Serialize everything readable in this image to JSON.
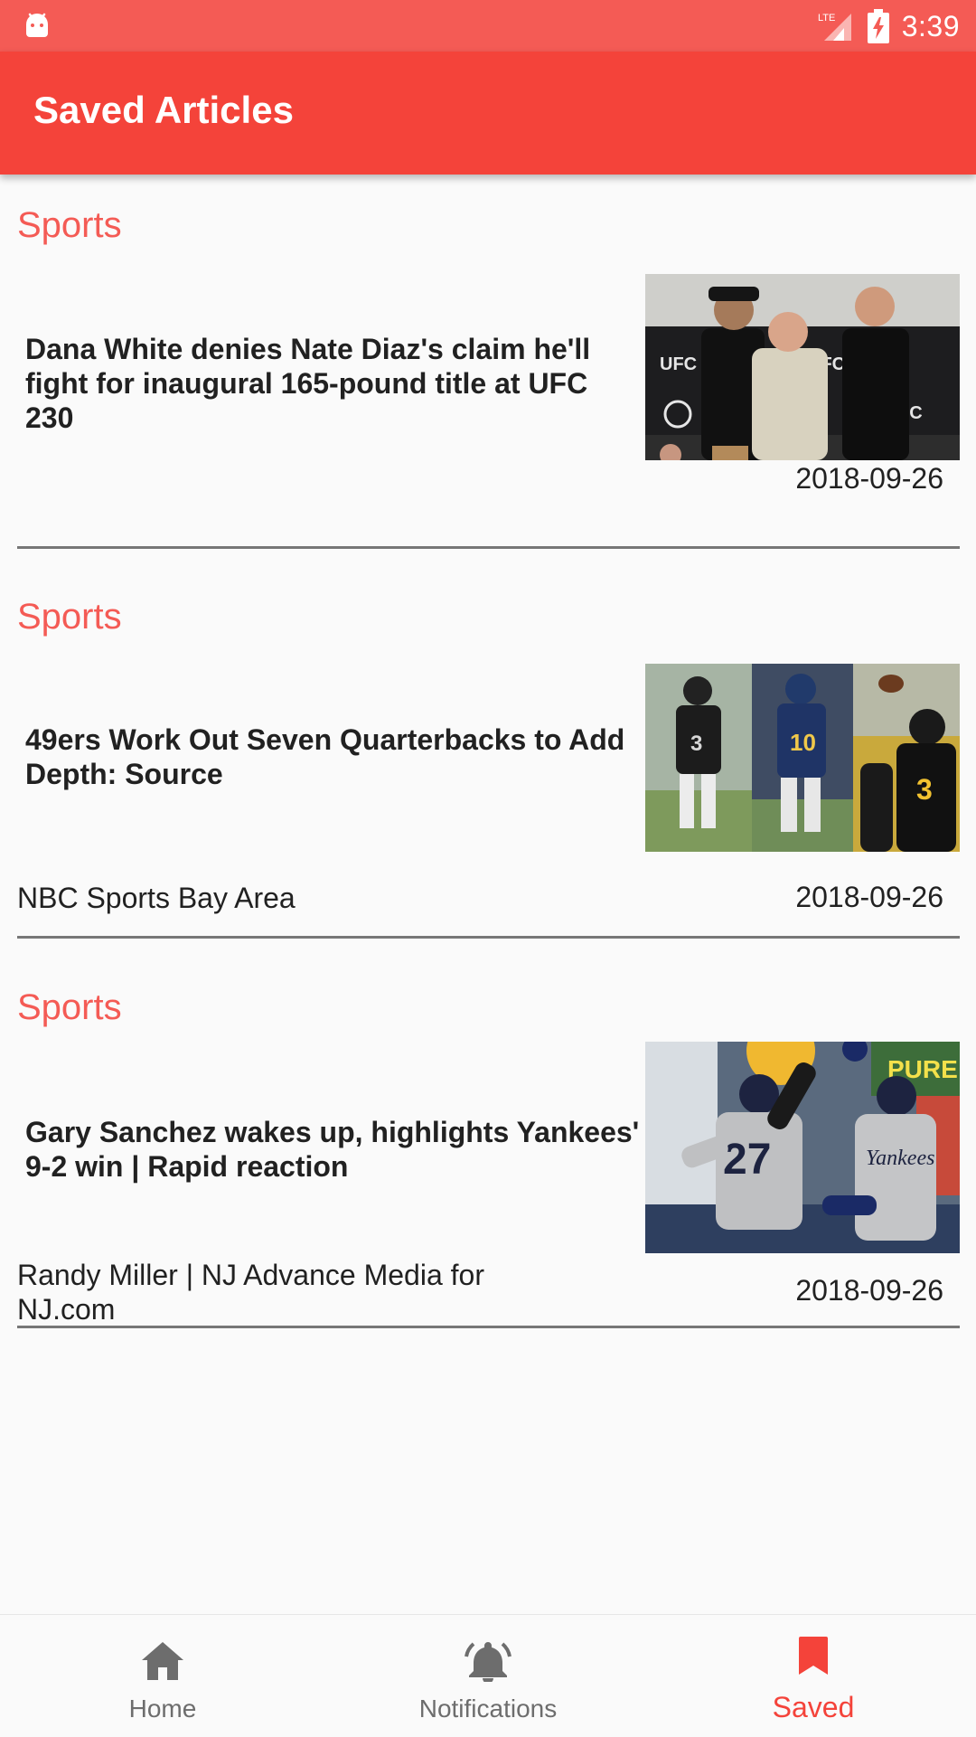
{
  "status_bar": {
    "time": "3:39",
    "network": "LTE"
  },
  "app_bar": {
    "title": "Saved Articles"
  },
  "articles": [
    {
      "category": "Sports",
      "headline": "Dana White denies Nate Diaz's claim he'll fight for inaugural 165-pound title at UFC 230",
      "source": "",
      "date": "2018-09-26"
    },
    {
      "category": "Sports",
      "headline": "49ers Work Out Seven Quarterbacks to Add Depth: Source",
      "source": "NBC Sports Bay Area",
      "date": "2018-09-26"
    },
    {
      "category": "Sports",
      "headline": "Gary Sanchez wakes up, highlights Yankees' 9-2 win | Rapid reaction",
      "source": "Randy Miller | NJ Advance Media for NJ.com",
      "date": "2018-09-26"
    }
  ],
  "bottom_nav": {
    "items": [
      {
        "label": "Home",
        "icon": "home-icon",
        "active": false
      },
      {
        "label": "Notifications",
        "icon": "bell-icon",
        "active": false
      },
      {
        "label": "Saved",
        "icon": "bookmark-icon",
        "active": true
      }
    ]
  },
  "colors": {
    "status_bar": "#f45b55",
    "app_bar": "#f4433a",
    "accent": "#f4433a",
    "category": "#f45b55",
    "nav_inactive": "#6d6d6d"
  }
}
